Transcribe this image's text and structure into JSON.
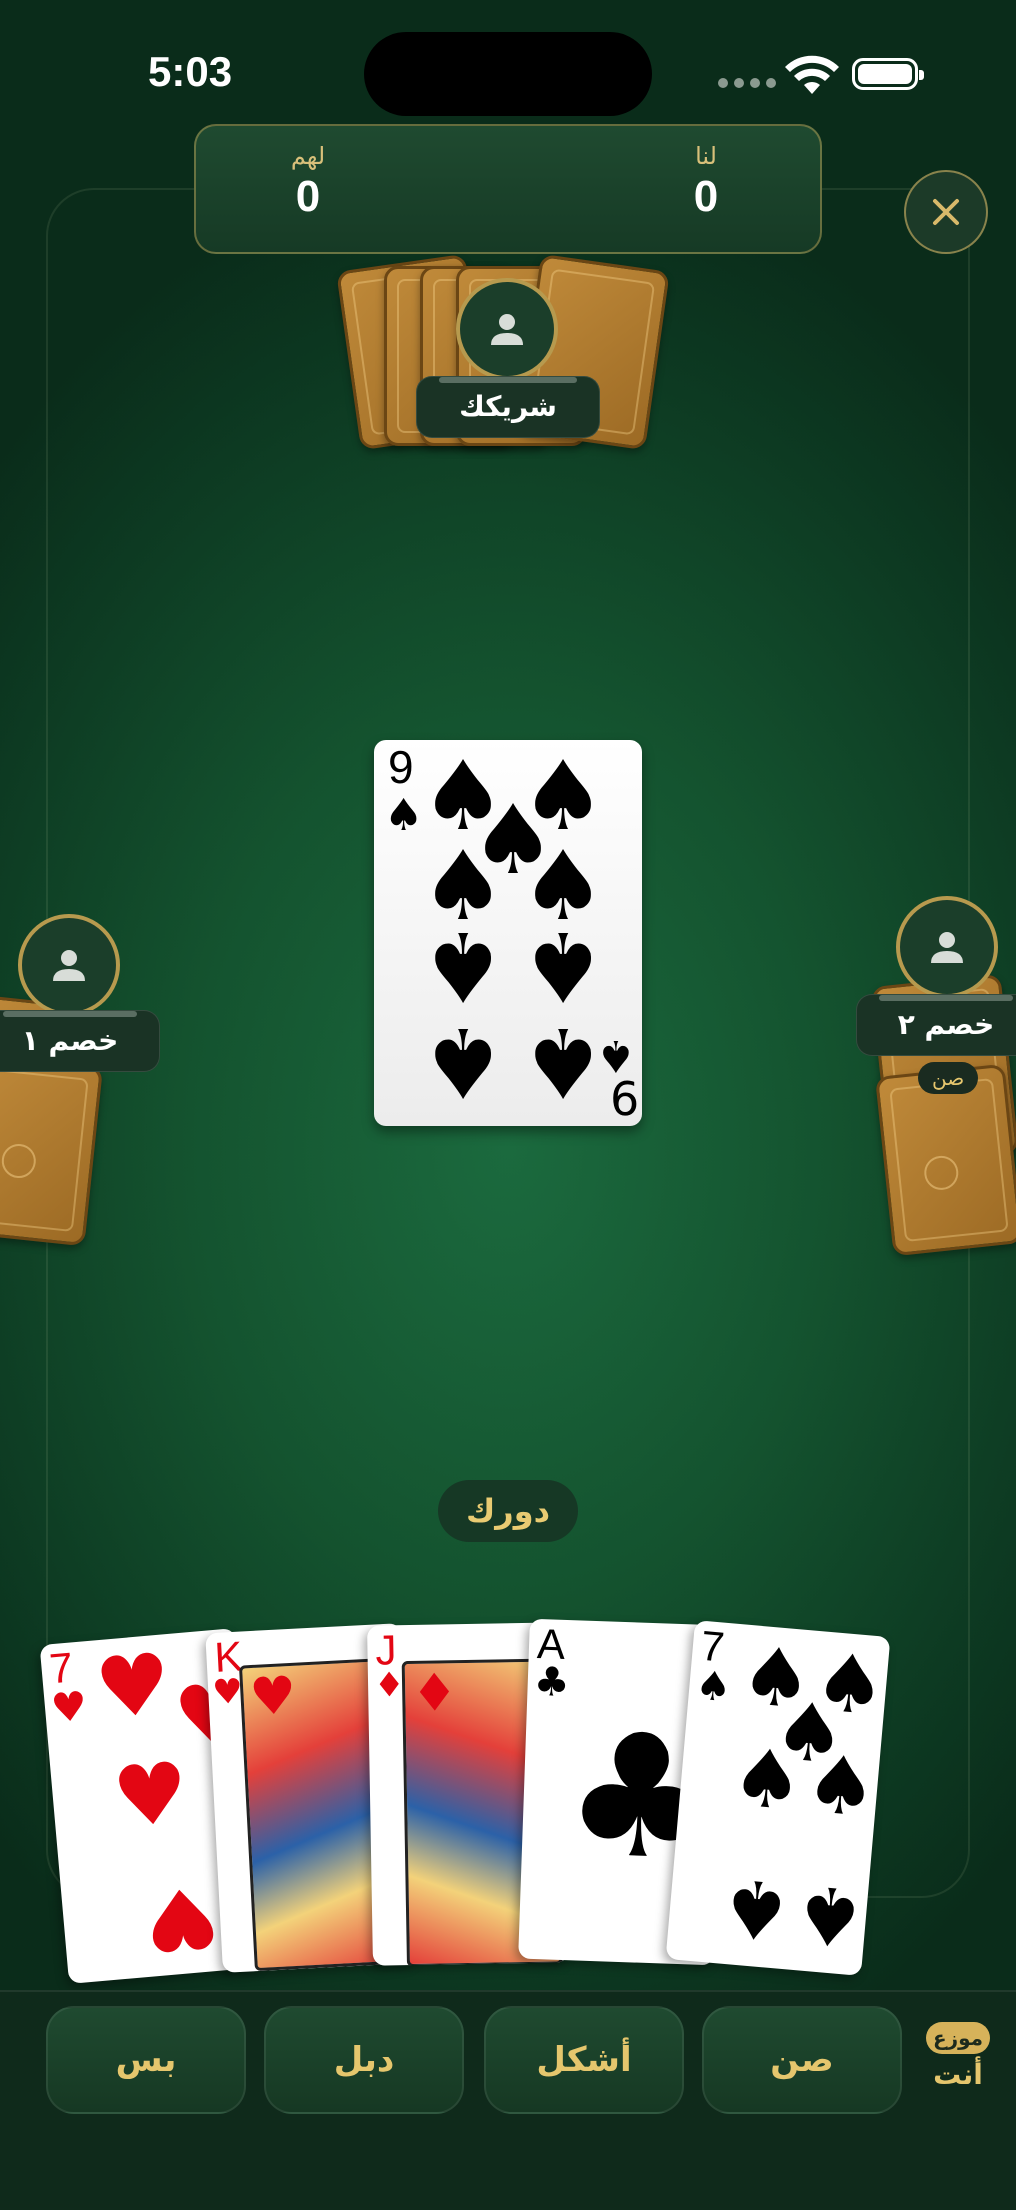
{
  "status_bar": {
    "time": "5:03"
  },
  "scoreboard": {
    "us": {
      "label": "لنا",
      "value": "0"
    },
    "them": {
      "label": "لهم",
      "value": "0"
    }
  },
  "players": {
    "partner": {
      "name": "شريكك"
    },
    "opponent_1": {
      "name": "خصم ١"
    },
    "opponent_2": {
      "name": "خصم ٢",
      "badge": "صن"
    }
  },
  "center_card": {
    "rank": "9",
    "suit": "spades"
  },
  "turn": {
    "label": "دورك"
  },
  "hand": [
    {
      "rank": "7",
      "suit": "hearts",
      "symbol": "♥"
    },
    {
      "rank": "K",
      "suit": "hearts",
      "symbol": "♥"
    },
    {
      "rank": "J",
      "suit": "diamonds",
      "symbol": "♦"
    },
    {
      "rank": "A",
      "suit": "clubs",
      "symbol": "♣"
    },
    {
      "rank": "7",
      "suit": "spades",
      "symbol": "♠"
    }
  ],
  "actions": {
    "pass": "بس",
    "double": "دبل",
    "hokom": "أشكل",
    "sun": "صن"
  },
  "dealer": {
    "chip": "موزع",
    "label": "أنت"
  },
  "colors": {
    "felt": "#14532f",
    "gold": "#e5c66d",
    "card_red": "#e30613"
  },
  "icons": {
    "close": "close-icon",
    "avatar": "person-icon",
    "wifi": "wifi-icon",
    "battery": "battery-icon"
  }
}
